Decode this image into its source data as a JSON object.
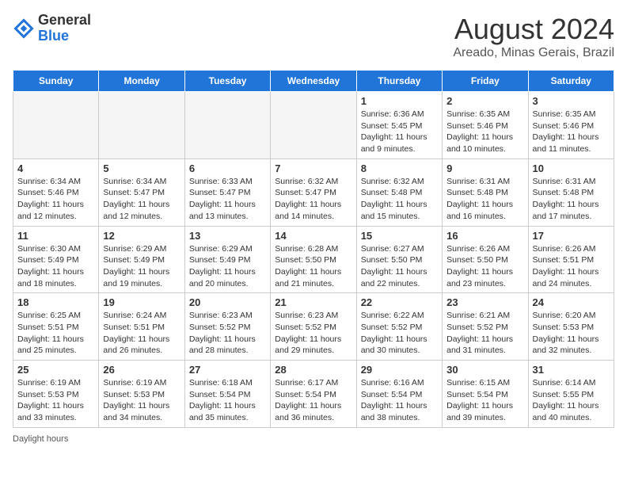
{
  "logo": {
    "general": "General",
    "blue": "Blue"
  },
  "title": "August 2024",
  "subtitle": "Areado, Minas Gerais, Brazil",
  "weekdays": [
    "Sunday",
    "Monday",
    "Tuesday",
    "Wednesday",
    "Thursday",
    "Friday",
    "Saturday"
  ],
  "weeks": [
    [
      {
        "day": "",
        "info": ""
      },
      {
        "day": "",
        "info": ""
      },
      {
        "day": "",
        "info": ""
      },
      {
        "day": "",
        "info": ""
      },
      {
        "day": "1",
        "info": "Sunrise: 6:36 AM\nSunset: 5:45 PM\nDaylight: 11 hours and 9 minutes."
      },
      {
        "day": "2",
        "info": "Sunrise: 6:35 AM\nSunset: 5:46 PM\nDaylight: 11 hours and 10 minutes."
      },
      {
        "day": "3",
        "info": "Sunrise: 6:35 AM\nSunset: 5:46 PM\nDaylight: 11 hours and 11 minutes."
      }
    ],
    [
      {
        "day": "4",
        "info": "Sunrise: 6:34 AM\nSunset: 5:46 PM\nDaylight: 11 hours and 12 minutes."
      },
      {
        "day": "5",
        "info": "Sunrise: 6:34 AM\nSunset: 5:47 PM\nDaylight: 11 hours and 12 minutes."
      },
      {
        "day": "6",
        "info": "Sunrise: 6:33 AM\nSunset: 5:47 PM\nDaylight: 11 hours and 13 minutes."
      },
      {
        "day": "7",
        "info": "Sunrise: 6:32 AM\nSunset: 5:47 PM\nDaylight: 11 hours and 14 minutes."
      },
      {
        "day": "8",
        "info": "Sunrise: 6:32 AM\nSunset: 5:48 PM\nDaylight: 11 hours and 15 minutes."
      },
      {
        "day": "9",
        "info": "Sunrise: 6:31 AM\nSunset: 5:48 PM\nDaylight: 11 hours and 16 minutes."
      },
      {
        "day": "10",
        "info": "Sunrise: 6:31 AM\nSunset: 5:48 PM\nDaylight: 11 hours and 17 minutes."
      }
    ],
    [
      {
        "day": "11",
        "info": "Sunrise: 6:30 AM\nSunset: 5:49 PM\nDaylight: 11 hours and 18 minutes."
      },
      {
        "day": "12",
        "info": "Sunrise: 6:29 AM\nSunset: 5:49 PM\nDaylight: 11 hours and 19 minutes."
      },
      {
        "day": "13",
        "info": "Sunrise: 6:29 AM\nSunset: 5:49 PM\nDaylight: 11 hours and 20 minutes."
      },
      {
        "day": "14",
        "info": "Sunrise: 6:28 AM\nSunset: 5:50 PM\nDaylight: 11 hours and 21 minutes."
      },
      {
        "day": "15",
        "info": "Sunrise: 6:27 AM\nSunset: 5:50 PM\nDaylight: 11 hours and 22 minutes."
      },
      {
        "day": "16",
        "info": "Sunrise: 6:26 AM\nSunset: 5:50 PM\nDaylight: 11 hours and 23 minutes."
      },
      {
        "day": "17",
        "info": "Sunrise: 6:26 AM\nSunset: 5:51 PM\nDaylight: 11 hours and 24 minutes."
      }
    ],
    [
      {
        "day": "18",
        "info": "Sunrise: 6:25 AM\nSunset: 5:51 PM\nDaylight: 11 hours and 25 minutes."
      },
      {
        "day": "19",
        "info": "Sunrise: 6:24 AM\nSunset: 5:51 PM\nDaylight: 11 hours and 26 minutes."
      },
      {
        "day": "20",
        "info": "Sunrise: 6:23 AM\nSunset: 5:52 PM\nDaylight: 11 hours and 28 minutes."
      },
      {
        "day": "21",
        "info": "Sunrise: 6:23 AM\nSunset: 5:52 PM\nDaylight: 11 hours and 29 minutes."
      },
      {
        "day": "22",
        "info": "Sunrise: 6:22 AM\nSunset: 5:52 PM\nDaylight: 11 hours and 30 minutes."
      },
      {
        "day": "23",
        "info": "Sunrise: 6:21 AM\nSunset: 5:52 PM\nDaylight: 11 hours and 31 minutes."
      },
      {
        "day": "24",
        "info": "Sunrise: 6:20 AM\nSunset: 5:53 PM\nDaylight: 11 hours and 32 minutes."
      }
    ],
    [
      {
        "day": "25",
        "info": "Sunrise: 6:19 AM\nSunset: 5:53 PM\nDaylight: 11 hours and 33 minutes."
      },
      {
        "day": "26",
        "info": "Sunrise: 6:19 AM\nSunset: 5:53 PM\nDaylight: 11 hours and 34 minutes."
      },
      {
        "day": "27",
        "info": "Sunrise: 6:18 AM\nSunset: 5:54 PM\nDaylight: 11 hours and 35 minutes."
      },
      {
        "day": "28",
        "info": "Sunrise: 6:17 AM\nSunset: 5:54 PM\nDaylight: 11 hours and 36 minutes."
      },
      {
        "day": "29",
        "info": "Sunrise: 6:16 AM\nSunset: 5:54 PM\nDaylight: 11 hours and 38 minutes."
      },
      {
        "day": "30",
        "info": "Sunrise: 6:15 AM\nSunset: 5:54 PM\nDaylight: 11 hours and 39 minutes."
      },
      {
        "day": "31",
        "info": "Sunrise: 6:14 AM\nSunset: 5:55 PM\nDaylight: 11 hours and 40 minutes."
      }
    ]
  ],
  "footer": "Daylight hours"
}
